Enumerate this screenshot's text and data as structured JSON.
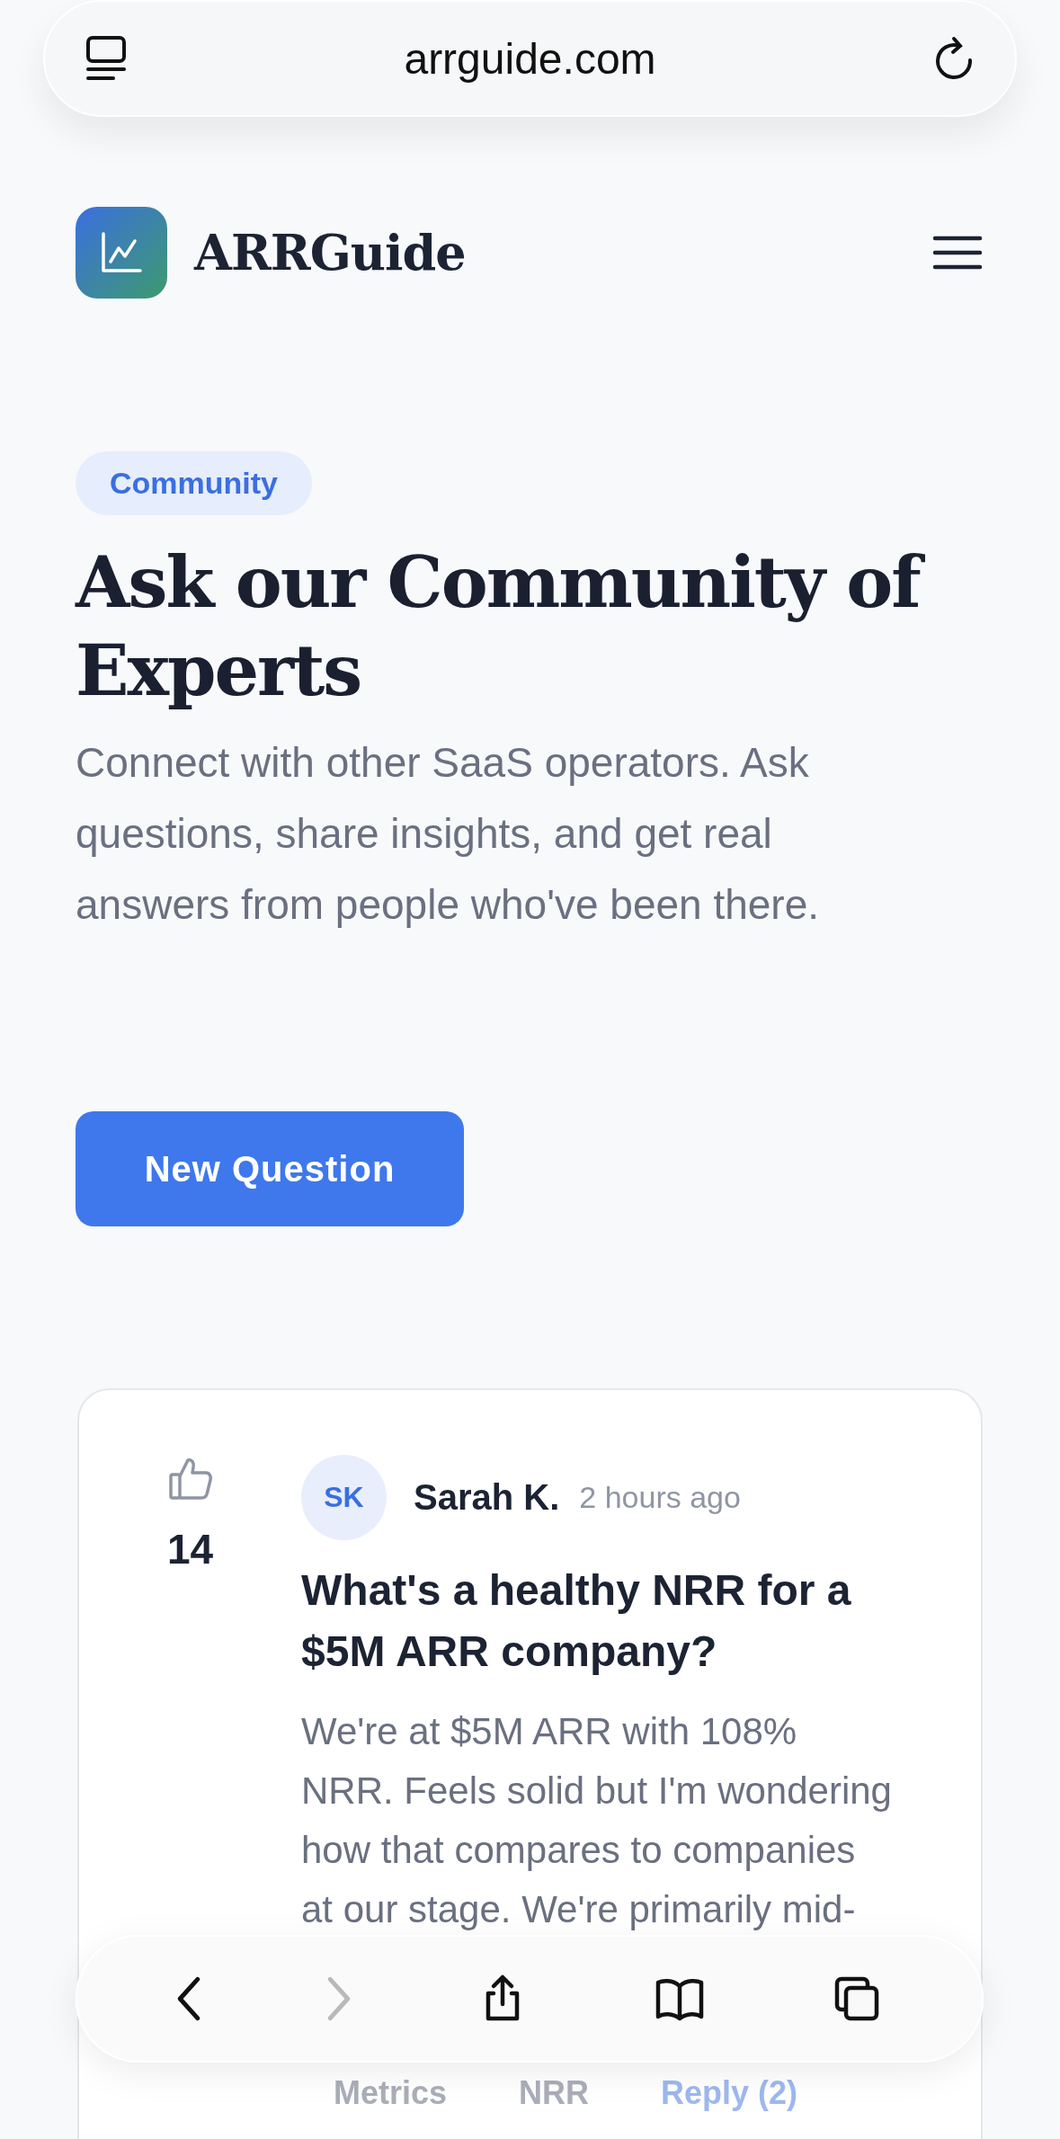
{
  "browser": {
    "url": "arrguide.com",
    "toolbar": [
      {
        "kind": "back",
        "disabled": false
      },
      {
        "kind": "forward",
        "disabled": true
      },
      {
        "kind": "share",
        "disabled": false
      },
      {
        "kind": "bookmarks",
        "disabled": false
      },
      {
        "kind": "tabs",
        "disabled": false
      }
    ]
  },
  "header": {
    "brand": "ARRGuide"
  },
  "hero": {
    "badge": "Community",
    "title": "Ask our Community of Experts",
    "description": "Connect with other SaaS operators. Ask questions, share insights, and get real answers from people who've been there.",
    "button": "New Question"
  },
  "questions": [
    {
      "votes": "14",
      "initials": "SK",
      "author": "Sarah K.",
      "time": "2 hours ago",
      "title": "What's a healthy NRR for a $5M ARR company?",
      "body": "We're at $5M ARR with 108% NRR. Feels solid but I'm wondering how that compares to companies at our stage. We're primarily mid-",
      "tags": [
        "Metrics",
        "NRR"
      ],
      "reply": "Reply (2)"
    }
  ]
}
